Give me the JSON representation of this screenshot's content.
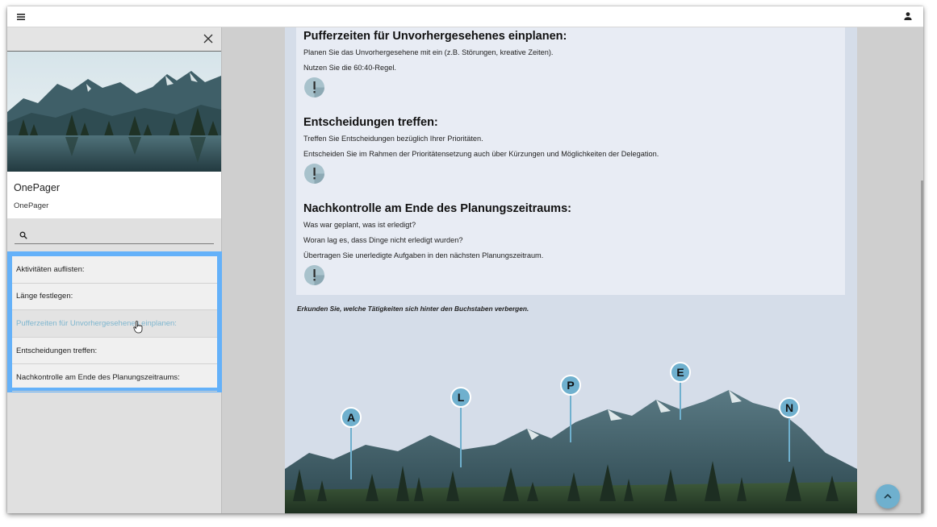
{
  "topbar": {
    "menu_icon": "hamburger-menu-icon",
    "user_icon": "person-icon"
  },
  "sidebar": {
    "close_icon": "close-icon",
    "hero_image": "mountain-lake-landscape",
    "card": {
      "title": "OnePager",
      "subtitle": "OnePager"
    },
    "search": {
      "placeholder": "",
      "value": "",
      "icon": "search-icon"
    },
    "items": [
      {
        "label": "Aktivitäten auflisten:"
      },
      {
        "label": "Länge festlegen:"
      },
      {
        "label": "Pufferzeiten für Unvorhergesehenes einplanen:"
      },
      {
        "label": "Entscheidungen treffen:"
      },
      {
        "label": "Nachkontrolle am Ende des Planungszeitraums:"
      }
    ],
    "selection_color": "#64b1f9",
    "active_color": "#7eb6cf"
  },
  "main": {
    "sections": [
      {
        "title": "Pufferzeiten für Unvorhergesehenes einplanen:",
        "lines": [
          "Planen Sie das Unvorhergesehene mit ein (z.B. Störungen, kreative Zeiten).",
          "Nutzen Sie die 60:40-Regel."
        ]
      },
      {
        "title": "Entscheidungen treffen:",
        "lines": [
          "Treffen Sie Entscheidungen bezüglich Ihrer Prioritäten.",
          "Entscheiden Sie im Rahmen der Prioritätensetzung auch über Kürzungen und Möglichkeiten der Delegation."
        ]
      },
      {
        "title": "Nachkontrolle am Ende des Planungszeitraums:",
        "lines": [
          "Was war geplant, was ist erledigt?",
          "Woran lag es, dass Dinge nicht erledigt wurden?",
          "Übertragen Sie unerledigte Aufgaben in den nächsten Planungszeitraum."
        ]
      }
    ],
    "alert_icon": "exclamation-icon",
    "caption": "Erkunden Sie, welche Tätigkeiten sich hinter den Buchstaben verbergen.",
    "markers": [
      {
        "letter": "A"
      },
      {
        "letter": "L"
      },
      {
        "letter": "P"
      },
      {
        "letter": "E"
      },
      {
        "letter": "N"
      }
    ],
    "marker_color": "#6fb0ce",
    "scroll_top_icon": "chevron-up-icon"
  }
}
